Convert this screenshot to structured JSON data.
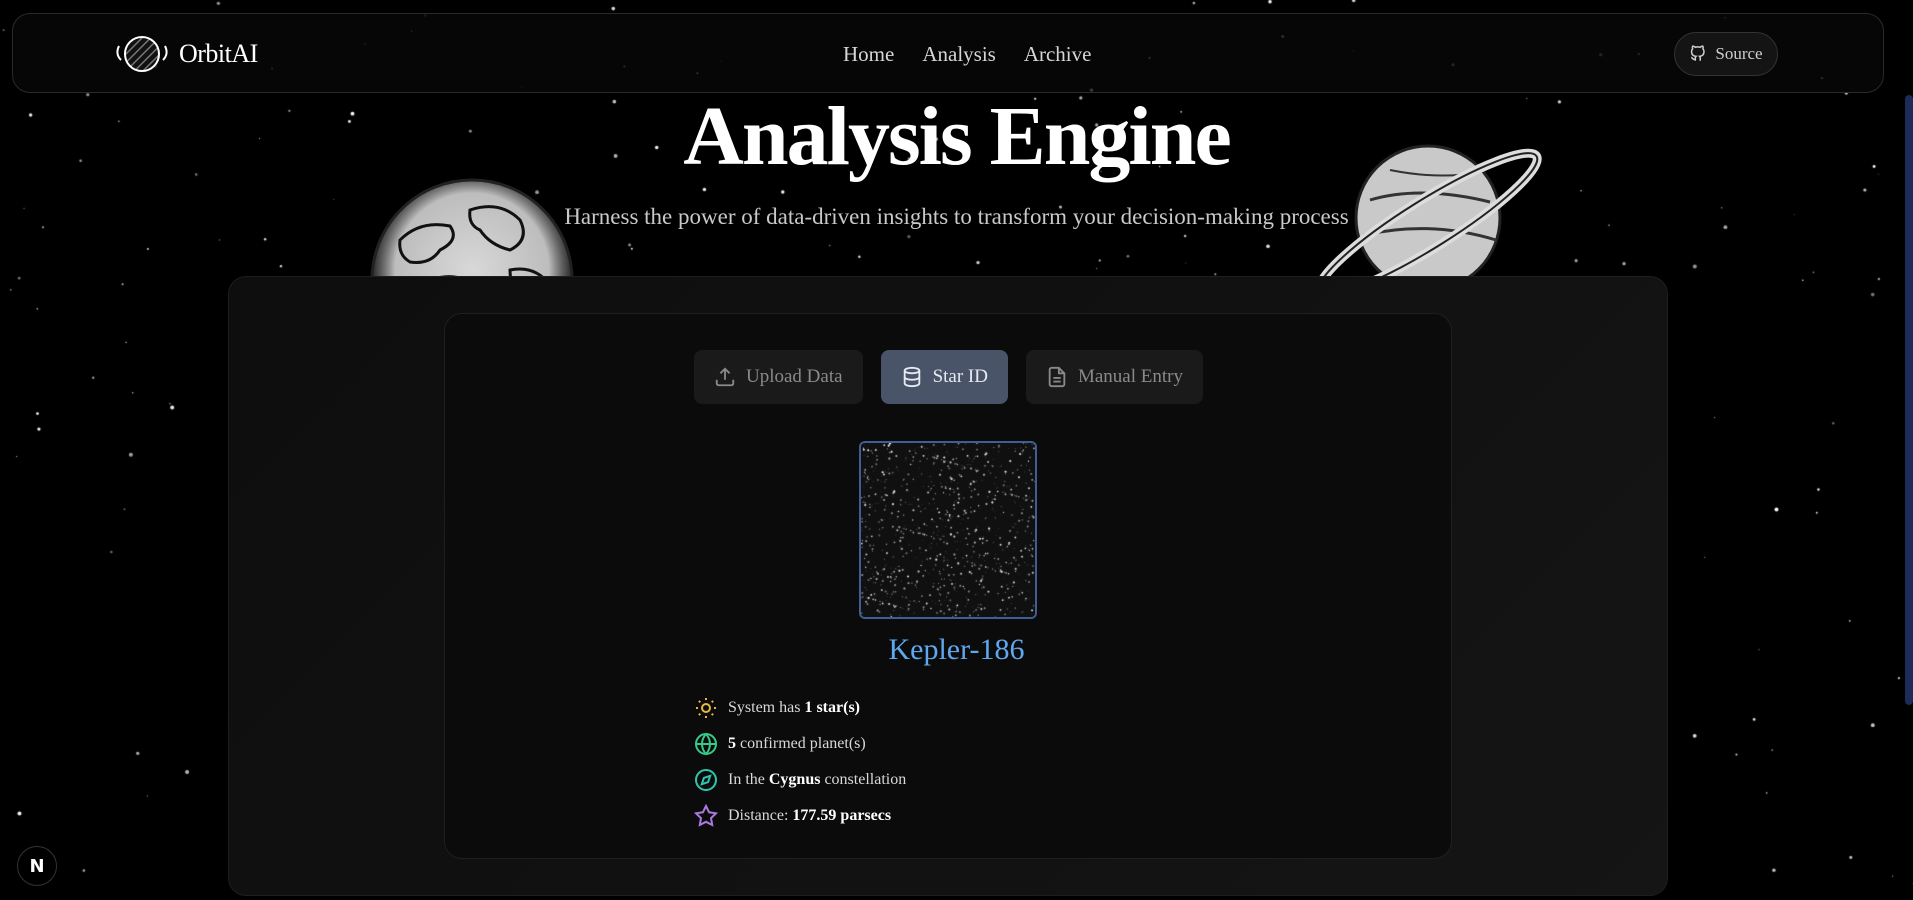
{
  "app": {
    "brand": "OrbitAI",
    "nav": [
      "Home",
      "Analysis",
      "Archive"
    ],
    "source_label": "Source"
  },
  "hero": {
    "title": "Analysis Engine",
    "subtitle": "Harness the power of data-driven insights to transform your decision-making process"
  },
  "tabs": [
    {
      "label": "Upload Data",
      "icon": "upload-icon",
      "active": false
    },
    {
      "label": "Star ID",
      "icon": "database-icon",
      "active": true
    },
    {
      "label": "Manual Entry",
      "icon": "document-icon",
      "active": false
    }
  ],
  "star": {
    "name": "Kepler-186",
    "facts": [
      {
        "icon": "sun-icon",
        "pre": "System has ",
        "value": "1 star(s)",
        "post": ""
      },
      {
        "icon": "globe-icon",
        "pre": "",
        "value": "5",
        "post": " confirmed planet(s)"
      },
      {
        "icon": "compass-icon",
        "pre": "In the ",
        "value": "Cygnus",
        "post": " constellation"
      },
      {
        "icon": "star-icon",
        "pre": "Distance: ",
        "value": "177.59 parsecs",
        "post": ""
      }
    ]
  },
  "colors": {
    "accent": "#5fa8f0",
    "active_tab": "#4a5468",
    "sun": "#e8b740",
    "globe": "#35c98a",
    "compass": "#2fc4b0",
    "star": "#a97ae0"
  },
  "next_badge": "N"
}
